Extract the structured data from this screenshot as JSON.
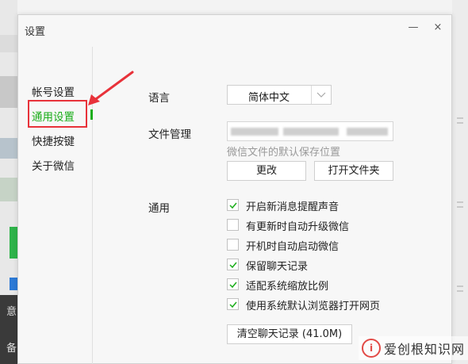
{
  "window": {
    "title": "设置",
    "minimize_glyph": "—",
    "close_glyph": "×"
  },
  "sidebar": {
    "items": [
      {
        "label": "帐号设置",
        "active": false
      },
      {
        "label": "通用设置",
        "active": true
      },
      {
        "label": "快捷按键",
        "active": false
      },
      {
        "label": "关于微信",
        "active": false
      }
    ]
  },
  "general": {
    "language_label": "语言",
    "language_value": "简体中文",
    "file_label": "文件管理",
    "file_hint": "微信文件的默认保存位置",
    "change_button": "更改",
    "open_folder_button": "打开文件夹",
    "general_label": "通用",
    "options": [
      {
        "label": "开启新消息提醒声音",
        "checked": true
      },
      {
        "label": "有更新时自动升级微信",
        "checked": false
      },
      {
        "label": "开机时自动启动微信",
        "checked": false
      },
      {
        "label": "保留聊天记录",
        "checked": true
      },
      {
        "label": "适配系统缩放比例",
        "checked": true
      },
      {
        "label": "使用系统默认浏览器打开网页",
        "checked": true
      }
    ],
    "clear_button": "清空聊天记录 (41.0M)"
  },
  "background": {
    "left_chars": [
      "意",
      "备"
    ]
  },
  "watermark": {
    "logo_text": "i",
    "text": "爱创根知识网"
  },
  "colors": {
    "accent_green": "#1aad19",
    "highlight_red": "#e8323a"
  },
  "icons": {
    "check": "check-icon",
    "caret": "chevron-down-icon",
    "close": "close-icon",
    "minimize": "minimize-icon",
    "arrow": "annotation-arrow-icon"
  }
}
